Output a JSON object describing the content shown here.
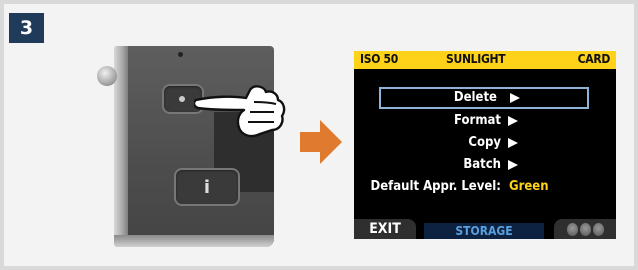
{
  "step": {
    "number": "3"
  },
  "lcd": {
    "top_bar": {
      "iso": "ISO 50",
      "white_balance": "SUNLIGHT",
      "storage": "CARD"
    },
    "menu_items": [
      {
        "label": "Delete",
        "selected": true
      },
      {
        "label": "Format"
      },
      {
        "label": "Copy"
      },
      {
        "label": "Batch"
      }
    ],
    "setting": {
      "label": "Default Appr. Level:",
      "value": "Green"
    },
    "bottom_bar": {
      "left": "EXIT",
      "center": "STORAGE"
    }
  },
  "colors": {
    "badge": "#1f3b59",
    "lcd_topbar": "#ffd21a",
    "arrow": "#e07a2e",
    "selection_border": "#8fb3d9",
    "storage_tab": "#0d2240"
  },
  "icons": [
    "hand-pointer-icon",
    "right-arrow-icon",
    "dials-icon"
  ]
}
